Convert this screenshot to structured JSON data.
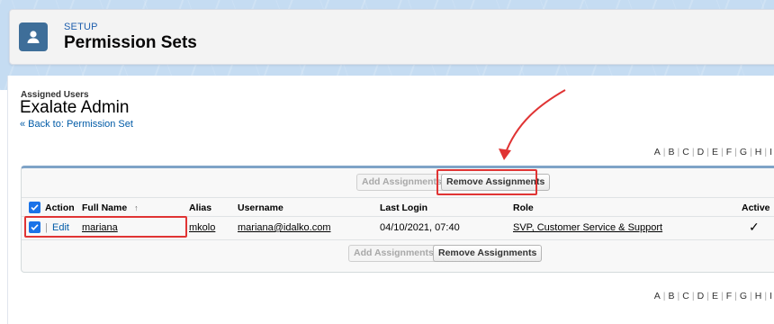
{
  "header": {
    "eyebrow": "SETUP",
    "title": "Permission Sets",
    "icon": "user-icon"
  },
  "page": {
    "section_label": "Assigned Users",
    "title": "Exalate Admin",
    "back_link": "« Back to: Permission Set"
  },
  "alpha_index": [
    "A",
    "B",
    "C",
    "D",
    "E",
    "F",
    "G",
    "H",
    "I"
  ],
  "buttons": {
    "add": "Add Assignments",
    "remove": "Remove Assignments"
  },
  "table": {
    "columns": {
      "action": "Action",
      "full_name": "Full Name",
      "sort_indicator": "↑",
      "alias": "Alias",
      "username": "Username",
      "last_login": "Last Login",
      "role": "Role",
      "active": "Active"
    },
    "rows": [
      {
        "edit": "Edit",
        "separator": "|",
        "full_name": "mariana",
        "alias": "mkolo",
        "username": "mariana@idalko.com",
        "last_login": "04/10/2021, 07:40",
        "role": "SVP, Customer Service & Support",
        "active": "✓"
      }
    ]
  },
  "colors": {
    "accent": "#015ba7",
    "highlight": "#e03434",
    "checkbox": "#1a73e8",
    "banner": "#c5dcf2"
  }
}
